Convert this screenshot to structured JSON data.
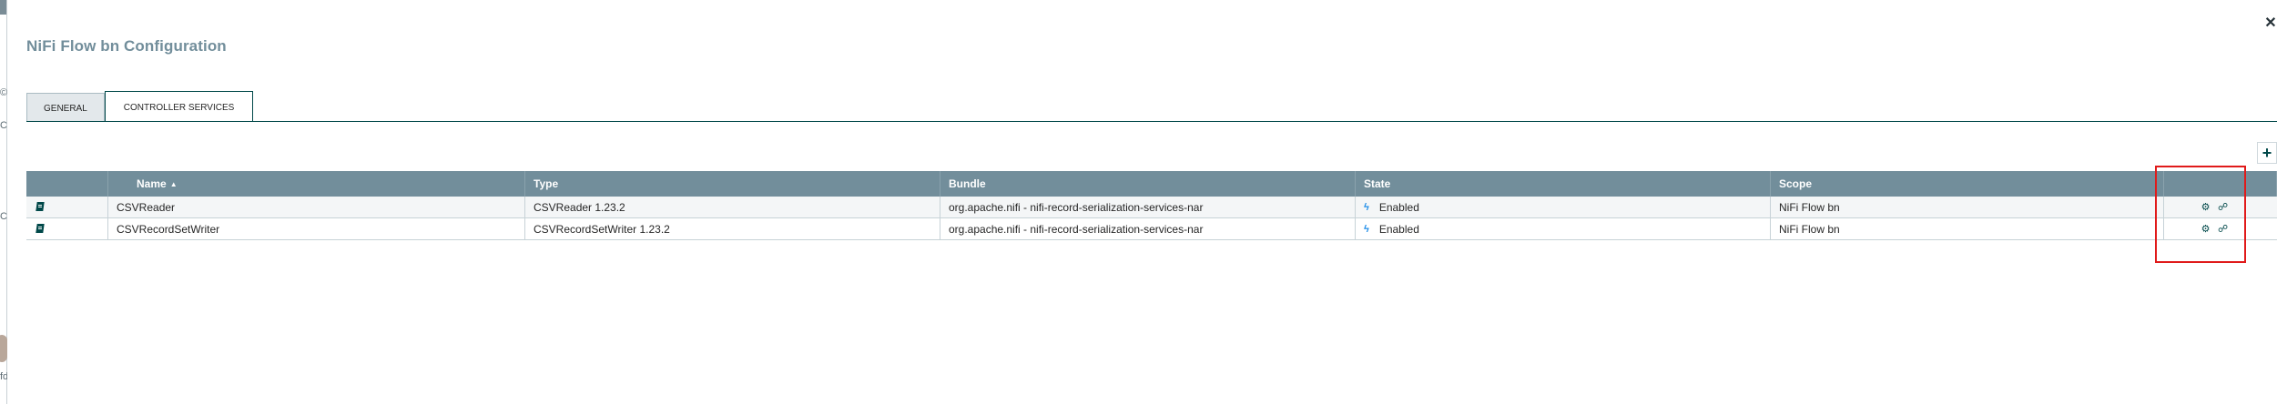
{
  "left_fragments": {
    "f1": "©",
    "f2": "C",
    "f3": "C",
    "f4": "fd"
  },
  "dialog": {
    "title": "NiFi Flow bn Configuration",
    "close_icon": "close-icon"
  },
  "tabs": [
    {
      "label": "GENERAL",
      "active": false
    },
    {
      "label": "CONTROLLER SERVICES",
      "active": true
    }
  ],
  "toolbar": {
    "add_icon": "plus-icon"
  },
  "grid": {
    "columns": {
      "name": "Name",
      "type": "Type",
      "bundle": "Bundle",
      "state": "State",
      "scope": "Scope"
    },
    "sort_indicator": "▲",
    "rows": [
      {
        "name": "CSVReader",
        "type": "CSVReader 1.23.2",
        "bundle": "org.apache.nifi - nifi-record-serialization-services-nar",
        "state": "Enabled",
        "scope": "NiFi Flow bn"
      },
      {
        "name": "CSVRecordSetWriter",
        "type": "CSVRecordSetWriter 1.23.2",
        "bundle": "org.apache.nifi - nifi-record-serialization-services-nar",
        "state": "Enabled",
        "scope": "NiFi Flow bn"
      }
    ]
  },
  "colors": {
    "header_bg": "#728e9b",
    "title": "#728e9b",
    "enabled_bolt": "#1d8ce8",
    "highlight": "#e01a1a"
  },
  "icons": {
    "row_icon": "documentation-icon",
    "state_icon": "enabled-bolt-icon",
    "action_1": "gear-icon",
    "action_2": "disable-icon"
  }
}
